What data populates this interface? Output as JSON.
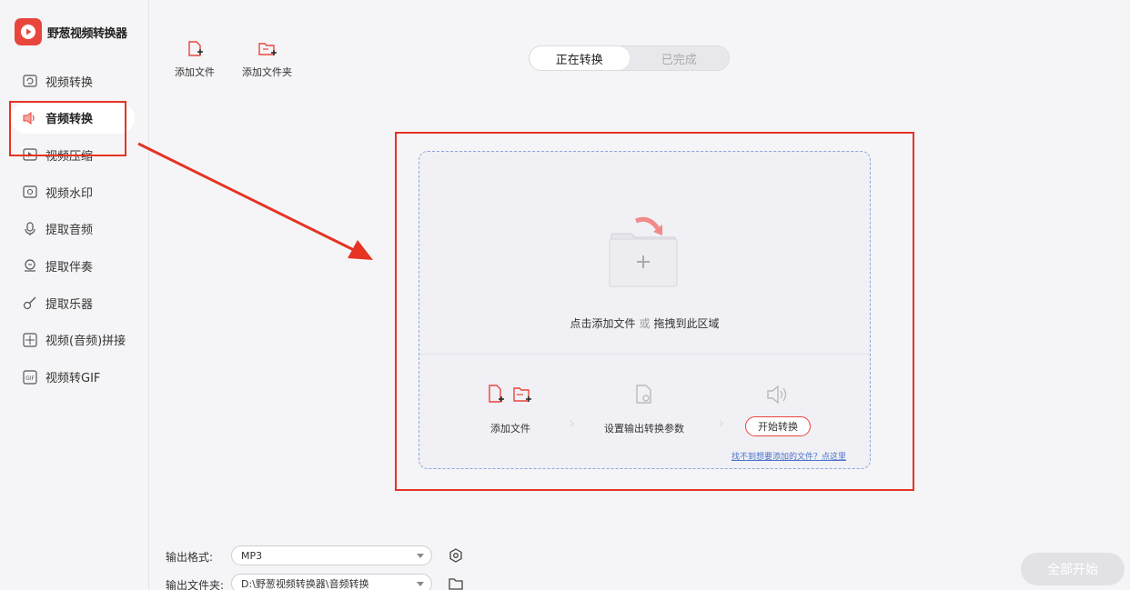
{
  "app": {
    "name": "野葱视频转换器"
  },
  "sidebar": {
    "items": [
      {
        "label": "视频转换",
        "icon": "video-convert-icon"
      },
      {
        "label": "音频转换",
        "icon": "audio-convert-icon",
        "active": true
      },
      {
        "label": "视频压缩",
        "icon": "video-compress-icon"
      },
      {
        "label": "视频水印",
        "icon": "video-watermark-icon"
      },
      {
        "label": "提取音频",
        "icon": "extract-audio-icon"
      },
      {
        "label": "提取伴奏",
        "icon": "extract-accompaniment-icon"
      },
      {
        "label": "提取乐器",
        "icon": "extract-instrument-icon"
      },
      {
        "label": "视频(音频)拼接",
        "icon": "merge-icon"
      },
      {
        "label": "视频转GIF",
        "icon": "gif-icon"
      }
    ]
  },
  "toolbar": {
    "add_file": "添加文件",
    "add_folder": "添加文件夹"
  },
  "tabs": {
    "converting": "正在转换",
    "completed": "已完成"
  },
  "dropzone": {
    "click_add": "点击添加文件",
    "or": "或",
    "drag_here": "拖拽到此区域",
    "step1": "添加文件",
    "step2": "设置输出转换参数",
    "step3": "开始转换",
    "help": "找不到想要添加的文件？点这里"
  },
  "output": {
    "format_label": "输出格式:",
    "format_value": "MP3",
    "folder_label": "输出文件夹:",
    "folder_value": "D:\\野葱视频转换器\\音频转换"
  },
  "start_all": "全部开始",
  "colors": {
    "accent": "#e8463c",
    "annotation": "#e53324"
  }
}
